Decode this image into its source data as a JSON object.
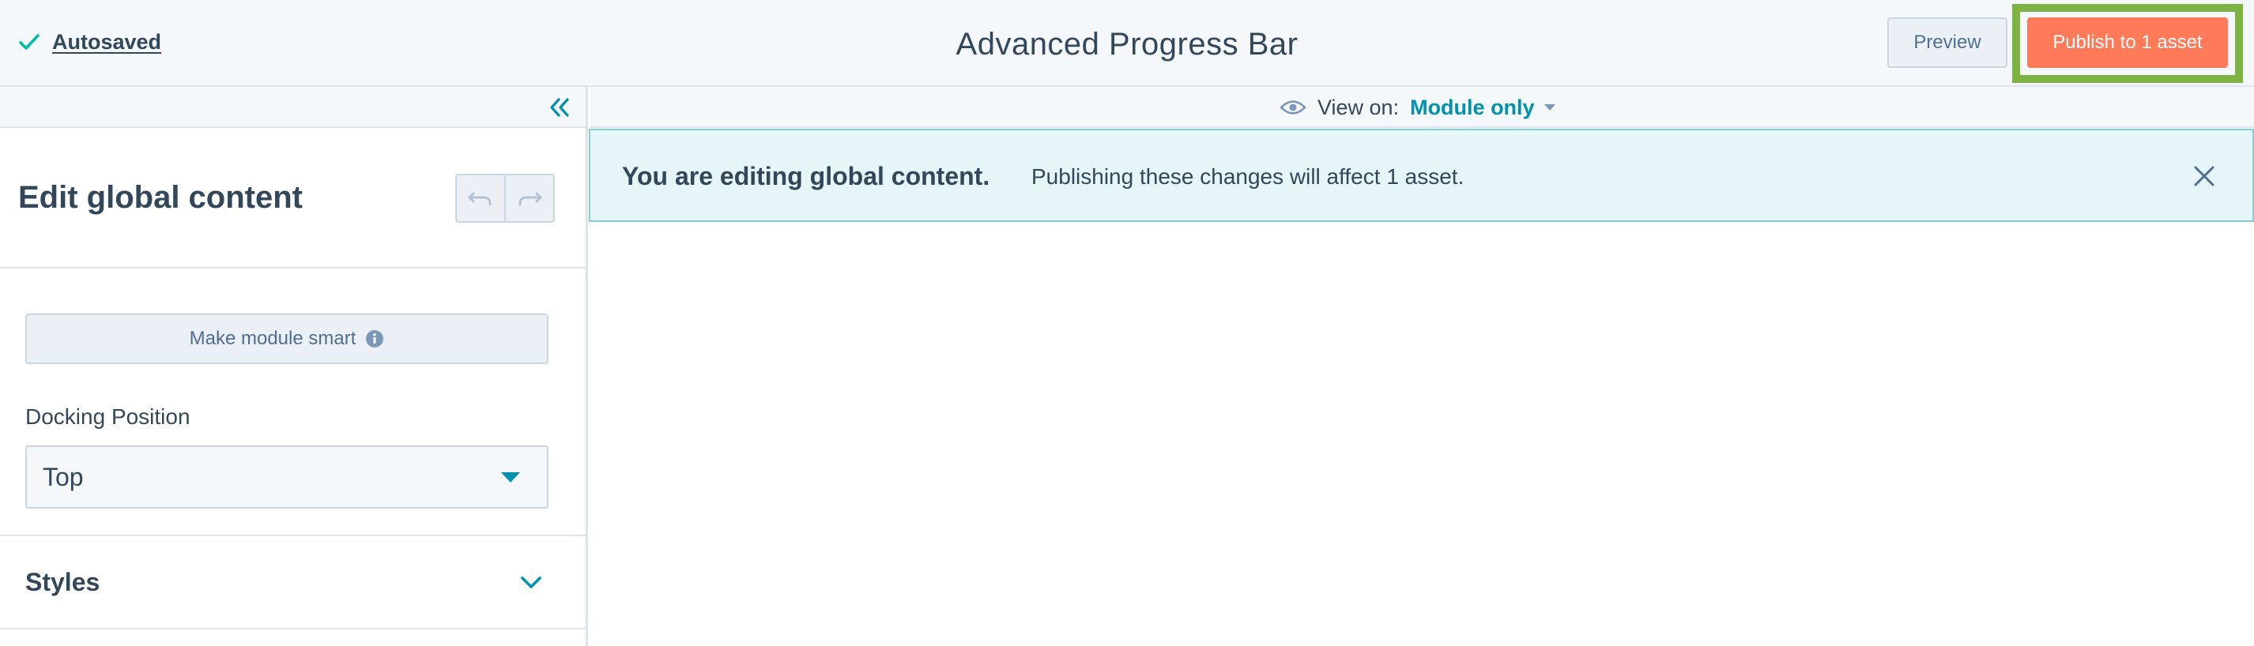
{
  "topbar": {
    "status": "Autosaved",
    "title": "Advanced Progress Bar",
    "preview_label": "Preview",
    "publish_label": "Publish to 1 asset"
  },
  "sidebar": {
    "title": "Edit global content",
    "smart_button_label": "Make module smart",
    "docking": {
      "label": "Docking Position",
      "selected": "Top"
    },
    "styles_label": "Styles"
  },
  "viewbar": {
    "label": "View on:",
    "value": "Module only"
  },
  "banner": {
    "title": "You are editing global content.",
    "text": "Publishing these changes will affect 1 asset."
  },
  "colors": {
    "accent": "#0091ae",
    "publish": "#ff7a59",
    "highlight": "#7cb342",
    "success": "#00bda5",
    "banner_bg": "#e5f5f8"
  },
  "icons": {
    "status": "check-icon",
    "collapse": "double-chevron-left-icon",
    "undo": "undo-icon",
    "redo": "redo-icon",
    "info": "info-icon",
    "dropdown": "caret-down-icon",
    "styles_toggle": "chevron-down-icon",
    "view": "eye-icon",
    "close": "close-icon"
  }
}
